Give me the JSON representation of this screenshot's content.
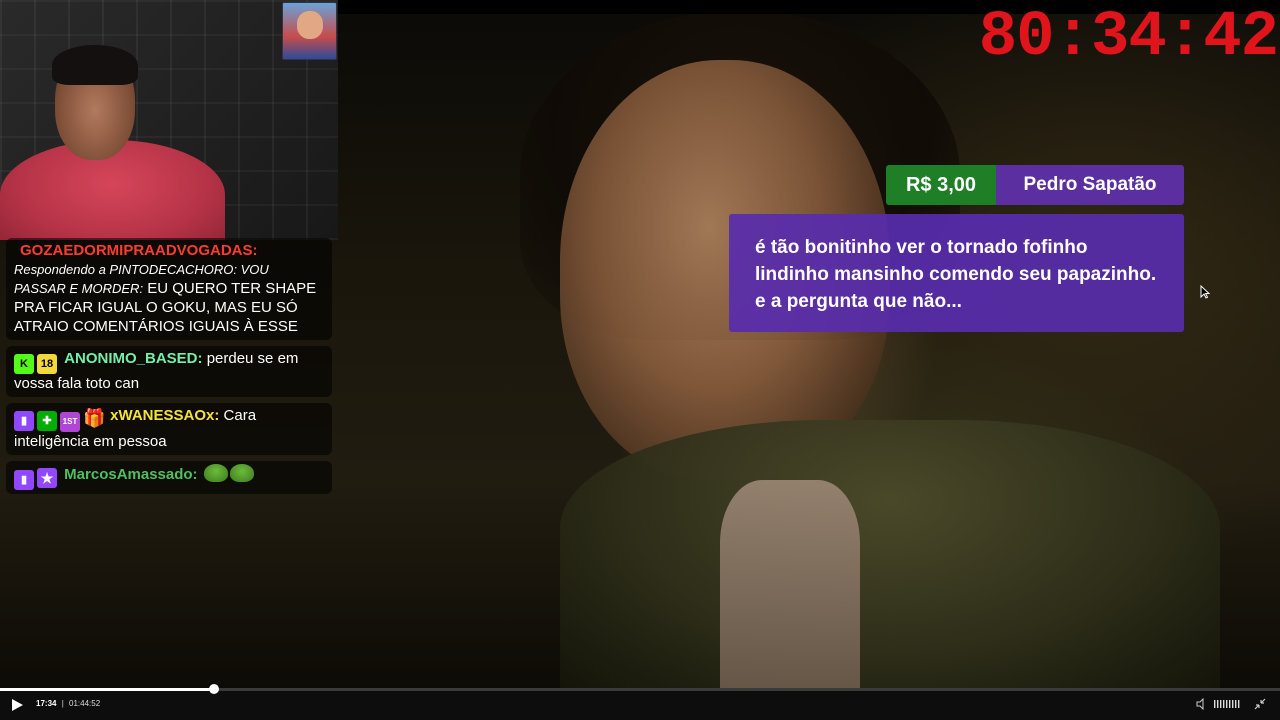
{
  "timer": "80:34:42",
  "donation": {
    "amount": "R$ 3,00",
    "name": "Pedro Sapatão",
    "message": "é tão bonitinho ver o tornado fofinho lindinho mansinho comendo seu papazinho. e a pergunta que não..."
  },
  "chat": [
    {
      "username": "GOZAEDORMIPRAADVOGADAS:",
      "username_color": "#ff3b30",
      "reply": "Respondendo a PINTODECACHORO: VOU PASSAR E MORDER:",
      "text": "EU QUERO TER SHAPE PRA FICAR IGUAL O GOKU, MAS EU SÓ ATRAIO COMENTÁRIOS IGUAIS À ESSE"
    },
    {
      "badges": [
        "kick-icon",
        "age-badge"
      ],
      "age_badge_text": "18",
      "username": "ANONIMO_BASED:",
      "username_color": "#72f0a8",
      "text": "perdeu se em vossa fala toto can"
    },
    {
      "badges": [
        "twitch-icon",
        "green-badge",
        "first-badge",
        "gift-icon"
      ],
      "first_badge_text": "1ST",
      "username": "xWANESSAOx:",
      "username_color": "#f2e33a",
      "text": "Cara inteligência em pessoa"
    },
    {
      "badges": [
        "twitch-icon",
        "star-badge"
      ],
      "username": "MarcosAmassado:",
      "username_color": "#4fbf60",
      "emotes": [
        "pepe-emote",
        "pepe-emote"
      ]
    }
  ],
  "player": {
    "current_time": "17:34",
    "separator": "|",
    "duration": "01:44:52",
    "progress": 0.1675
  }
}
